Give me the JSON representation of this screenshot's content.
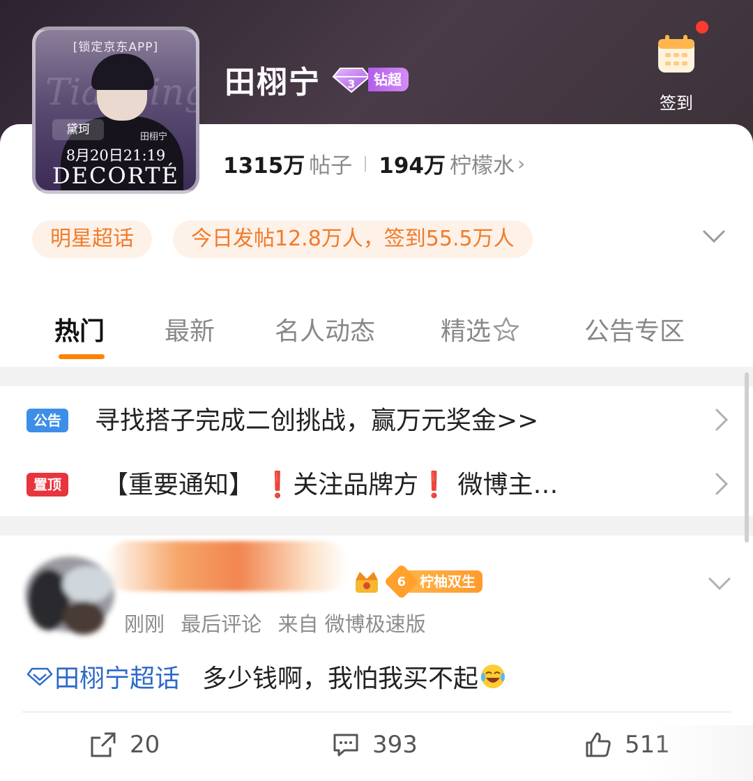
{
  "forum": {
    "title": "田栩宁",
    "level_label": "钻超",
    "avatar": {
      "lock_tag": "[锁定京东APP]",
      "script_text": "Tianning",
      "tag": "黛珂",
      "name_tag": "田栩宁",
      "date_line": "8月20日21:19",
      "brand": "DECORTÉ"
    },
    "stats": {
      "posts_value": "1315万",
      "posts_label": "帖子",
      "fans_value": "194万",
      "fans_label": "柠檬水"
    },
    "checkin_label": "签到",
    "category_pill": "明星超话",
    "activity_pill": "今日发帖12.8万人，签到55.5万人"
  },
  "tabs": [
    {
      "label": "热门"
    },
    {
      "label": "最新"
    },
    {
      "label": "名人动态"
    },
    {
      "label": "精选"
    },
    {
      "label": "公告专区"
    }
  ],
  "notices": [
    {
      "tag": "公告",
      "text": "寻找搭子完成二创挑战，赢万元奖金>>",
      "tag_color": "#3d8ee8"
    },
    {
      "tag": "置顶",
      "text": "【重要通知】  ❗关注品牌方❗  微博主…",
      "tag_color": "#e8343c"
    }
  ],
  "post": {
    "fan_level": "6",
    "fan_badge": "柠柚双生",
    "meta_time": "刚刚",
    "meta_comment": "最后评论",
    "meta_source": "来自 微博极速版",
    "topic": "田栩宁超话",
    "content": "多少钱啊，我怕我买不起",
    "reposts": "20",
    "comments": "393",
    "likes": "511"
  },
  "colors": {
    "accent_orange": "#ff8200",
    "topic_blue": "#2d69c7",
    "level_purple": "#b35de8"
  }
}
